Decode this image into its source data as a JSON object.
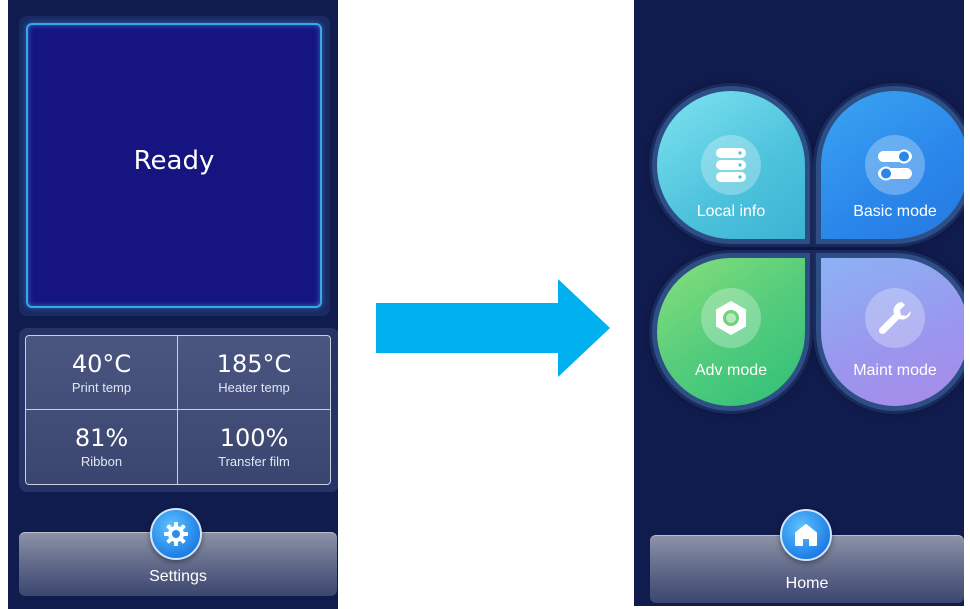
{
  "status_screen": {
    "status": "Ready",
    "stats": [
      {
        "value": "40°C",
        "label": "Print temp"
      },
      {
        "value": "185°C",
        "label": "Heater temp"
      },
      {
        "value": "81%",
        "label": "Ribbon"
      },
      {
        "value": "100%",
        "label": "Transfer film"
      }
    ],
    "settings_button": {
      "label": "Settings",
      "icon": "gear-icon"
    }
  },
  "arrow": {
    "icon": "arrow-right-icon",
    "color": "#00b0ef"
  },
  "menu_screen": {
    "tiles": [
      {
        "label": "Local info",
        "icon": "database-icon"
      },
      {
        "label": "Basic mode",
        "icon": "toggle-switch-icon"
      },
      {
        "label": "Adv mode",
        "icon": "hex-nut-icon"
      },
      {
        "label": "Maint mode",
        "icon": "wrench-icon"
      }
    ],
    "home_button": {
      "label": "Home",
      "icon": "home-icon"
    }
  },
  "colors": {
    "background": "#111c4e",
    "status_fill": "#151480",
    "accent": "#39a7e8"
  }
}
